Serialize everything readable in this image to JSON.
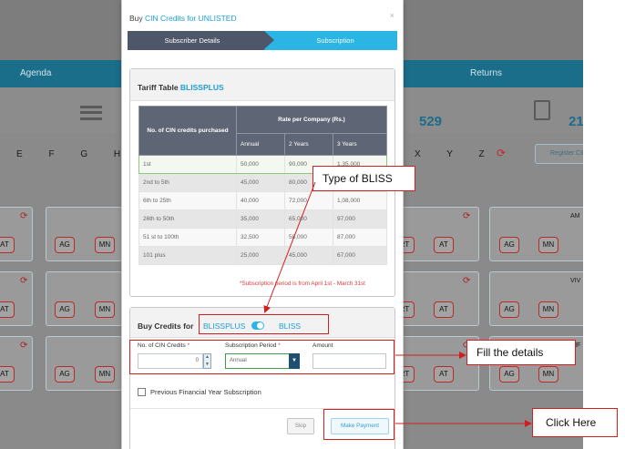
{
  "background": {
    "nav": {
      "agenda": "Agenda",
      "returns": "Returns"
    },
    "stats": [
      "529",
      "21"
    ],
    "alpha_left": "E F G H I",
    "alpha_right": "X Y Z",
    "register_label": "Register CIN",
    "chips": {
      "ag": "AG",
      "mn": "MN",
      "at": "AT",
      "rt": "RT"
    },
    "side_tags": [
      "AM",
      "VIV",
      "INF"
    ]
  },
  "modal": {
    "title_prefix": "Buy ",
    "title_highlight": "CIN Credits for UNLISTED",
    "close_glyph": "×",
    "steps": [
      {
        "label": "Subscriber Details"
      },
      {
        "label": "Subscription"
      }
    ],
    "tariff": {
      "title": "Tariff Table ",
      "plan": "BLISSPLUS",
      "head_left": "No. of CIN credits purchased",
      "head_group": "Rate per Company (Rs.)",
      "sub_headers": [
        "Annual",
        "2 Years",
        "3 Years"
      ],
      "rows": [
        {
          "range": "1st",
          "annual": "50,000",
          "y2": "90,000",
          "y3": "1,35,000"
        },
        {
          "range": "2nd to 5th",
          "annual": "45,000",
          "y2": "80,000",
          "y3": ""
        },
        {
          "range": "6th to 25th",
          "annual": "40,000",
          "y2": "72,000",
          "y3": "1,08,000"
        },
        {
          "range": "26th to 50th",
          "annual": "35,000",
          "y2": "65,000",
          "y3": "97,000"
        },
        {
          "range": "51 st to 100th",
          "annual": "32,500",
          "y2": "58,000",
          "y3": "87,000"
        },
        {
          "range": "101 plus",
          "annual": "25,000",
          "y2": "45,000",
          "y3": "67,000"
        }
      ],
      "note": "*Subscription period is from April 1st - March 31st"
    },
    "buy": {
      "title": "Buy Credits for",
      "plan_a": "BLISSPLUS",
      "plan_b": "BLISS",
      "fields": {
        "cin_label": "No. of CIN Credits",
        "cin_value": "0",
        "period_label": "Subscription Period",
        "period_value": "Annual",
        "amount_label": "Amount",
        "amount_value": ""
      },
      "required_mark": "*",
      "prev_fy_label": "Previous Financial Year Subscription",
      "skip_label": "Skip",
      "pay_label": "Make Payment"
    }
  },
  "annotations": {
    "type_of_bliss": "Type of BLISS",
    "fill_details": "Fill the details",
    "click_here": "Click Here",
    "color": "#d11f1f"
  }
}
